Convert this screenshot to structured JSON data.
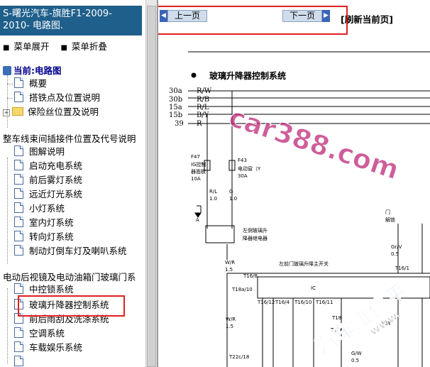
{
  "tree": {
    "title": "S-曙光汽车-旗胜F1-2009-\n2010- 电路图.",
    "expand_label": "菜单展开",
    "collapse_label": "菜单折叠",
    "current_label": "当前:电路图",
    "items": [
      {
        "label": "概要",
        "icon": "doc-icon"
      },
      {
        "label": "搭铁点及位置说明",
        "icon": "doc-icon"
      },
      {
        "label": "保险丝位置及说明",
        "icon": "folder-icon"
      },
      {
        "label": "整车线束间插接件位置及代号说明",
        "icon": "none"
      },
      {
        "label": "图解说明",
        "icon": "doc-icon"
      },
      {
        "label": "启动充电系统",
        "icon": "doc-icon"
      },
      {
        "label": "前后雾灯系统",
        "icon": "doc-icon"
      },
      {
        "label": "远近灯光系统",
        "icon": "doc-icon"
      },
      {
        "label": "小灯系统",
        "icon": "doc-icon"
      },
      {
        "label": "室内灯系统",
        "icon": "doc-icon"
      },
      {
        "label": "转向灯系统",
        "icon": "doc-icon"
      },
      {
        "label": "制动灯倒车灯及喇叭系统",
        "icon": "doc-icon"
      },
      {
        "label": "电动后视镜及电动油箱门玻璃门系",
        "icon": "none"
      },
      {
        "label": "中控锁系统",
        "icon": "doc-icon"
      },
      {
        "label": "玻璃升降器控制系统",
        "icon": "doc-icon"
      },
      {
        "label": "前后雨刮及洗涤系统",
        "icon": "doc-icon"
      },
      {
        "label": "空调系统",
        "icon": "doc-icon"
      },
      {
        "label": "车载娱乐系统",
        "icon": "doc-icon"
      },
      {
        "label": "",
        "icon": "doc-icon"
      }
    ]
  },
  "nav": {
    "prev_label": "上一页",
    "next_label": "下一页",
    "refresh_label": "[刷新当前页]"
  },
  "diagram": {
    "title": "玻璃升降器控制系统",
    "wires": [
      {
        "id": "30a",
        "color": "R/W"
      },
      {
        "id": "30b",
        "color": "R/B"
      },
      {
        "id": "15a",
        "color": "R/L"
      },
      {
        "id": "15b",
        "color": "B/Y"
      },
      {
        "id": "39",
        "color": "R"
      }
    ],
    "labels": {
      "f47": "F47",
      "ig": "IG控制",
      "panel": "器面板",
      "f47_amp": "10A",
      "f43": "F43",
      "window_ctrl": "电动窗（Y",
      "f43_amp": "30A",
      "rl": "R/L",
      "rl_size": "1.0",
      "g": "G",
      "g_size": "1.0",
      "a": "A",
      "relay1": "左侧玻璃升",
      "relay2": "降器继电器",
      "wr": "W/R",
      "wr_size": "1.5",
      "t16a10": "T18a/10",
      "t16a8": "T16/8",
      "main_switch": "左前门玻璃升降主开关",
      "ic": "IC",
      "door1": "门",
      "door2": "解锁",
      "gr_v": "Gr/V",
      "gr_size": "0.5",
      "t16_12": "T16/12",
      "t16_4": "T16/4",
      "t16_10": "T16/10",
      "t16_11": "T16/11",
      "t18": "T18",
      "t22c": "T22c/",
      "t22c18": "T22c/18",
      "wr2": "W/R",
      "wr2_size": "1.5",
      "gw": "G/W",
      "gw_size": "0.5",
      "t38": "T38",
      "t16_1": "T16/1"
    }
  },
  "watermark": {
    "text1": "car388.com",
    "text2": "汽车维修平",
    "text3": "www."
  },
  "colors": {
    "title_bar": "#1f5f8b",
    "highlight_box": "#e02020",
    "watermark": "#be2878",
    "nav_arrow": "#3a64b8"
  }
}
